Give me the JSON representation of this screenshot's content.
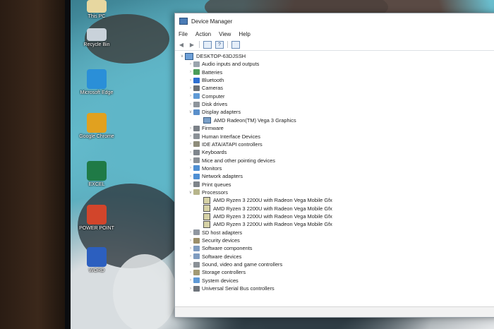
{
  "desktop": {
    "icons": [
      {
        "label": "This PC",
        "name": "this-pc-icon",
        "color": "#e7d7a0"
      },
      {
        "label": "Recycle Bin",
        "name": "recycle-bin-icon",
        "color": "#c9d2da"
      },
      {
        "label": "Microsoft Edge",
        "name": "edge-icon",
        "color": "#2a8fd8"
      },
      {
        "label": "Google Chrome",
        "name": "chrome-icon",
        "color": "#e1a11f"
      },
      {
        "label": "EXCEL",
        "name": "excel-icon",
        "color": "#1f7a46"
      },
      {
        "label": "POWER POINT",
        "name": "powerpoint-icon",
        "color": "#d2452b"
      },
      {
        "label": "WORD",
        "name": "word-icon",
        "color": "#2c5fbf"
      }
    ]
  },
  "window": {
    "title": "Device Manager",
    "menu": [
      "File",
      "Action",
      "View",
      "Help"
    ],
    "toolbar": [
      "back-arrow-icon",
      "forward-arrow-icon",
      "properties-icon",
      "help-icon",
      "scan-hardware-icon"
    ],
    "root": "DESKTOP-63DJSSH",
    "tree": [
      {
        "label": "Audio inputs and outputs",
        "icon": "speaker-icon",
        "color": "#9aa4ad",
        "expanded": false
      },
      {
        "label": "Batteries",
        "icon": "battery-icon",
        "color": "#4b9d5a",
        "expanded": false
      },
      {
        "label": "Bluetooth",
        "icon": "bluetooth-icon",
        "color": "#2e6fd1",
        "expanded": false
      },
      {
        "label": "Cameras",
        "icon": "camera-icon",
        "color": "#6a6f75",
        "expanded": false
      },
      {
        "label": "Computer",
        "icon": "computer-icon",
        "color": "#5f9ad6",
        "expanded": false
      },
      {
        "label": "Disk drives",
        "icon": "disk-icon",
        "color": "#8d949b",
        "expanded": false
      },
      {
        "label": "Display adapters",
        "icon": "display-icon",
        "color": "#5a8fca",
        "expanded": true,
        "children": [
          "AMD Radeon(TM) Vega 3 Graphics"
        ]
      },
      {
        "label": "Firmware",
        "icon": "firmware-icon",
        "color": "#7b8188",
        "expanded": false
      },
      {
        "label": "Human Interface Devices",
        "icon": "hid-icon",
        "color": "#8b9197",
        "expanded": false
      },
      {
        "label": "IDE ATA/ATAPI controllers",
        "icon": "ide-icon",
        "color": "#8e8c7a",
        "expanded": false
      },
      {
        "label": "Keyboards",
        "icon": "keyboard-icon",
        "color": "#7f868d",
        "expanded": false
      },
      {
        "label": "Mice and other pointing devices",
        "icon": "mouse-icon",
        "color": "#8a9096",
        "expanded": false
      },
      {
        "label": "Monitors",
        "icon": "monitor-icon",
        "color": "#4f8fd3",
        "expanded": false
      },
      {
        "label": "Network adapters",
        "icon": "network-icon",
        "color": "#4f8fd3",
        "expanded": false
      },
      {
        "label": "Print queues",
        "icon": "printer-icon",
        "color": "#7e848a",
        "expanded": false
      },
      {
        "label": "Processors",
        "icon": "processor-icon",
        "color": "#b7b58a",
        "expanded": true,
        "children": [
          "AMD Ryzen 3 2200U with Radeon Vega Mobile Gfx",
          "AMD Ryzen 3 2200U with Radeon Vega Mobile Gfx",
          "AMD Ryzen 3 2200U with Radeon Vega Mobile Gfx",
          "AMD Ryzen 3 2200U with Radeon Vega Mobile Gfx"
        ]
      },
      {
        "label": "SD host adapters",
        "icon": "sd-icon",
        "color": "#9097a0",
        "expanded": false
      },
      {
        "label": "Security devices",
        "icon": "security-icon",
        "color": "#9c8f6a",
        "expanded": false
      },
      {
        "label": "Software components",
        "icon": "software-components-icon",
        "color": "#7f9cc0",
        "expanded": false
      },
      {
        "label": "Software devices",
        "icon": "software-devices-icon",
        "color": "#7f9cc0",
        "expanded": false
      },
      {
        "label": "Sound, video and game controllers",
        "icon": "sound-icon",
        "color": "#8a9096",
        "expanded": false
      },
      {
        "label": "Storage controllers",
        "icon": "storage-icon",
        "color": "#a29a73",
        "expanded": false
      },
      {
        "label": "System devices",
        "icon": "system-icon",
        "color": "#5f9ad6",
        "expanded": false
      },
      {
        "label": "Universal Serial Bus controllers",
        "icon": "usb-icon",
        "color": "#6f757c",
        "expanded": false
      }
    ]
  }
}
